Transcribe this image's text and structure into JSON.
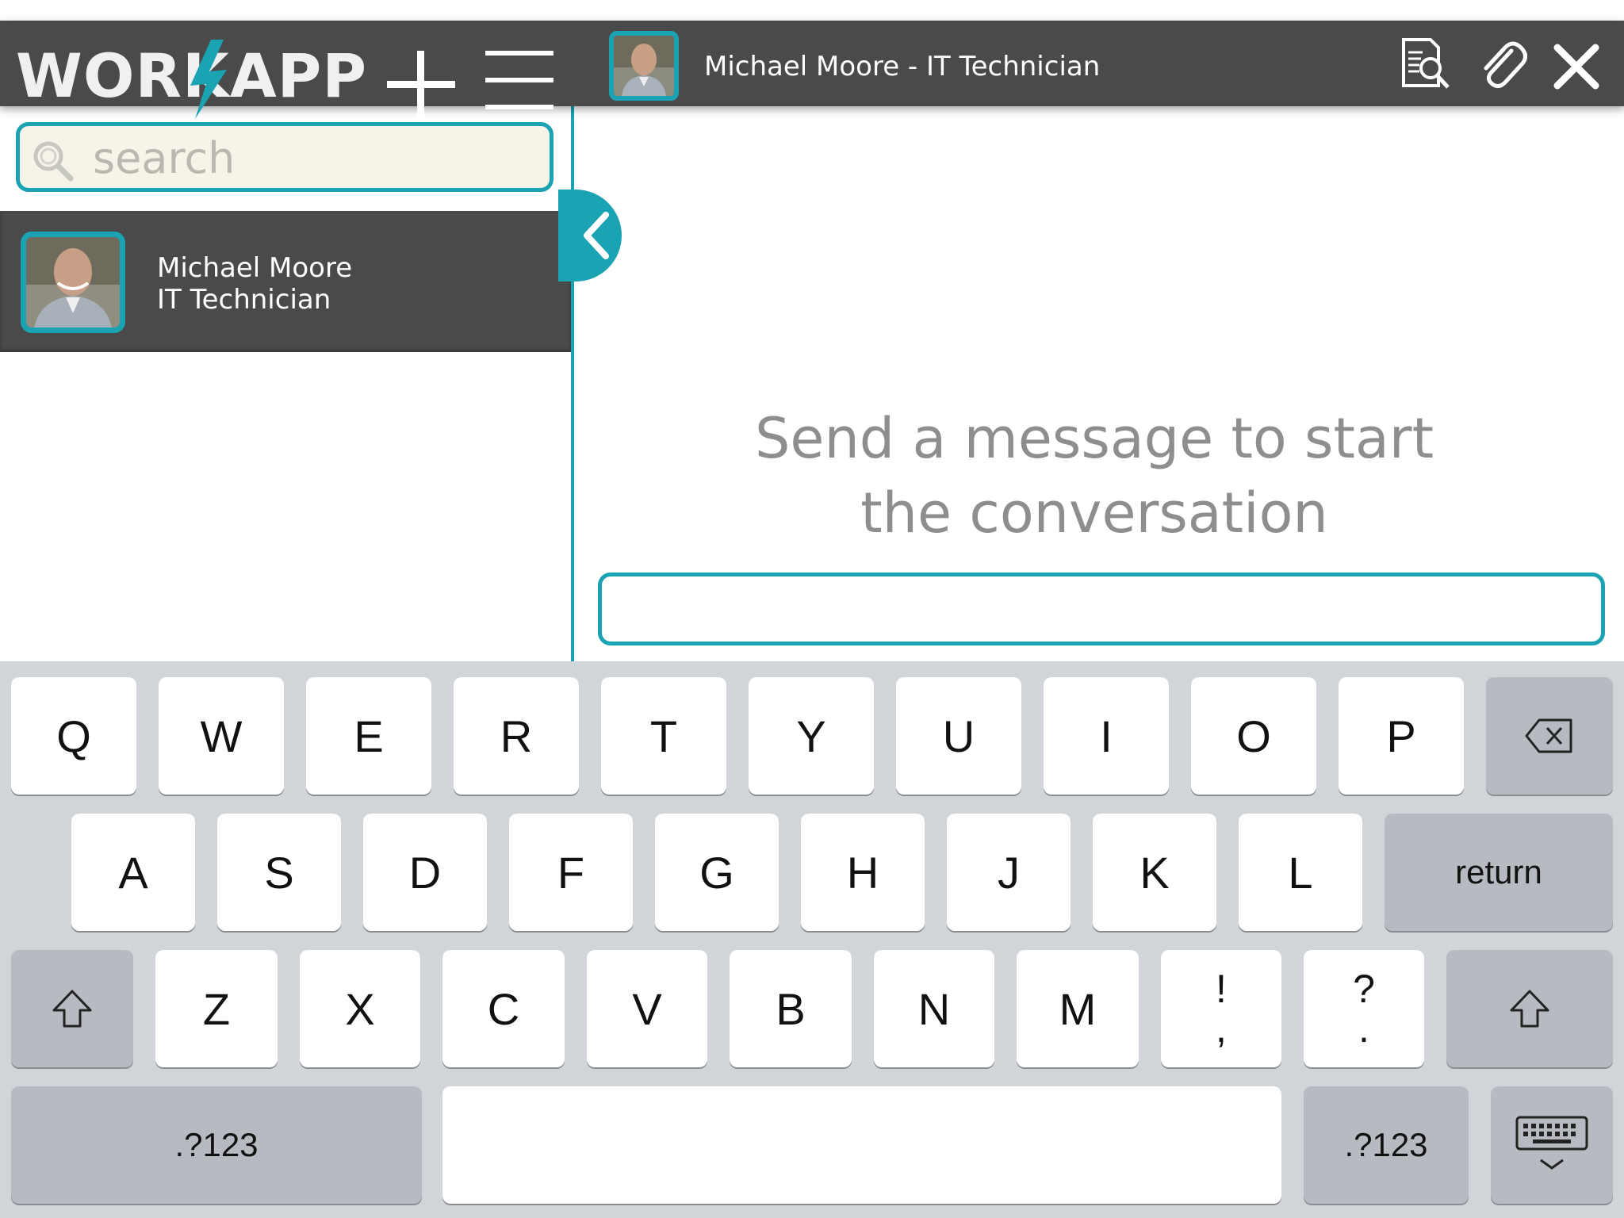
{
  "app": {
    "logo_text": "WORKAPP"
  },
  "header": {
    "title": "Michael Moore - IT Technician"
  },
  "search": {
    "placeholder": "search"
  },
  "contacts": [
    {
      "name": "Michael Moore",
      "role": "IT Technician"
    }
  ],
  "conversation": {
    "empty_line1": "Send a message to start",
    "empty_line2": "the conversation",
    "input_value": ""
  },
  "colors": {
    "accent": "#1aa3b3",
    "bar": "#4a4a4a",
    "keyboard_bg": "#d1d4d8"
  },
  "keyboard": {
    "row1": [
      "Q",
      "W",
      "E",
      "R",
      "T",
      "Y",
      "U",
      "I",
      "O",
      "P"
    ],
    "row2": [
      "A",
      "S",
      "D",
      "F",
      "G",
      "H",
      "J",
      "K",
      "L"
    ],
    "row3": [
      "Z",
      "X",
      "C",
      "V",
      "B",
      "N",
      "M"
    ],
    "punct1": [
      "!",
      ","
    ],
    "punct2": [
      "?",
      "."
    ],
    "return_label": "return",
    "numbers_label": ".?123"
  }
}
